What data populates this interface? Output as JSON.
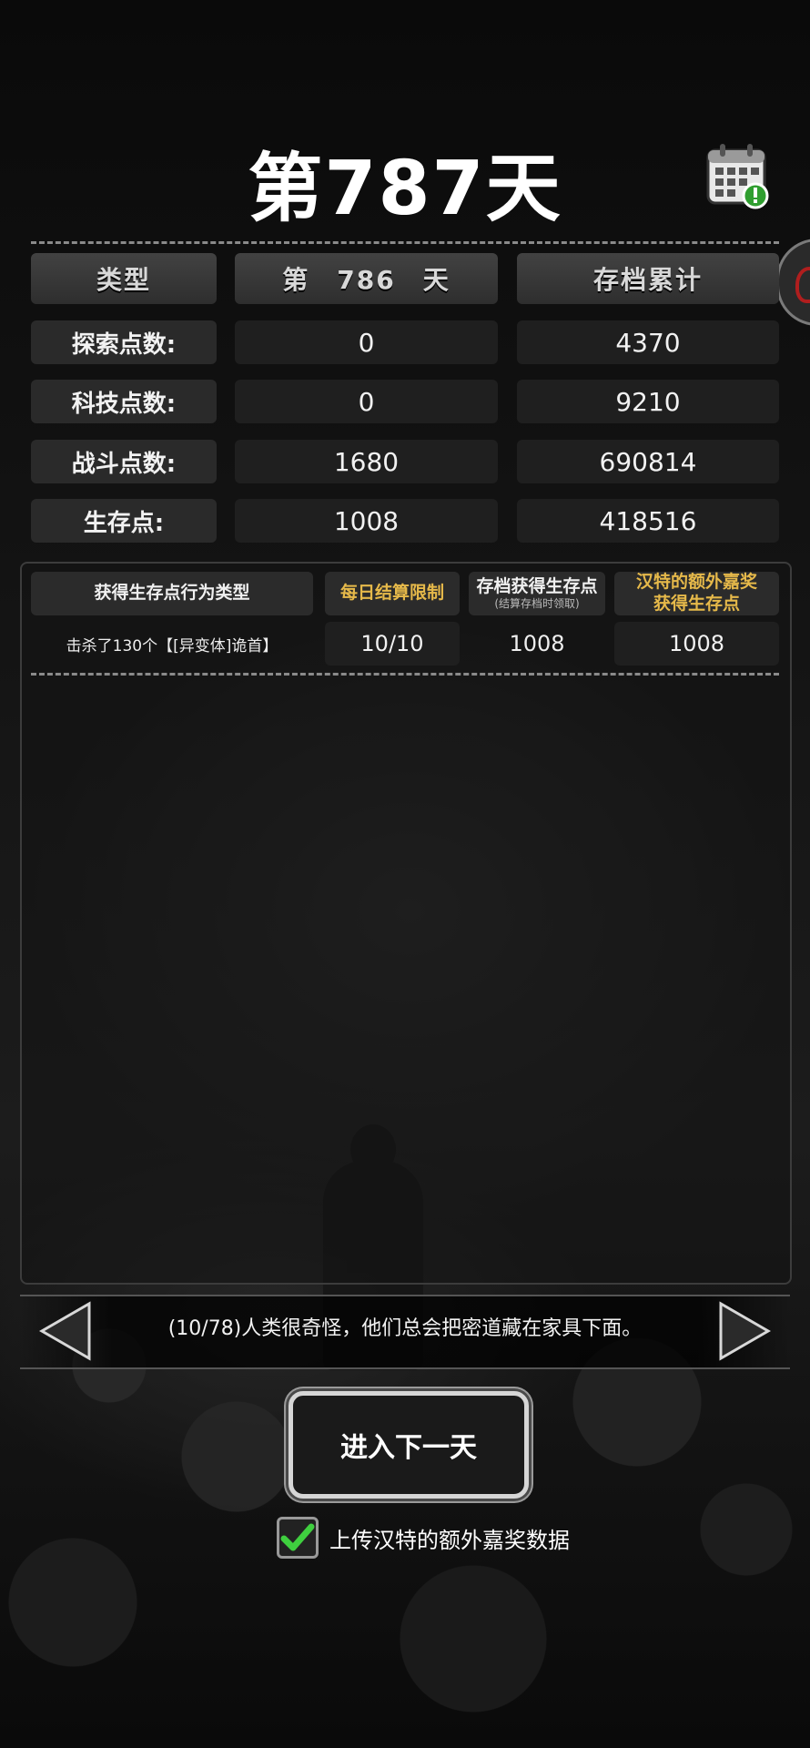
{
  "header": {
    "title": "第787天"
  },
  "stats_table": {
    "headers": [
      "类型",
      "第　786　天",
      "存档累计"
    ],
    "rows": [
      {
        "label": "探索点数:",
        "day": "0",
        "total": "4370"
      },
      {
        "label": "科技点数:",
        "day": "0",
        "total": "9210"
      },
      {
        "label": "战斗点数:",
        "day": "1680",
        "total": "690814"
      },
      {
        "label": "生存点:",
        "day": "1008",
        "total": "418516"
      }
    ]
  },
  "survival_table": {
    "header_type": "获得生存点行为类型",
    "header_limit": "每日结算限制",
    "header_save": "存档获得生存点",
    "header_save_note": "(结算存档时领取)",
    "header_bonus_line1": "汉特的额外嘉奖",
    "header_bonus_line2": "获得生存点",
    "rows": [
      {
        "action": "击杀了130个【[异变体]诡首】",
        "limit": "10/10",
        "save": "1008",
        "bonus": "1008"
      }
    ]
  },
  "tip": {
    "text": "(10/78)人类很奇怪，他们总会把密道藏在家具下面。"
  },
  "next_day_button": "进入下一天",
  "upload_option": {
    "label": "上传汉特的额外嘉奖数据",
    "checked": true
  },
  "colors": {
    "gold": "#e6b94a",
    "check_green": "#3fcf3f"
  }
}
